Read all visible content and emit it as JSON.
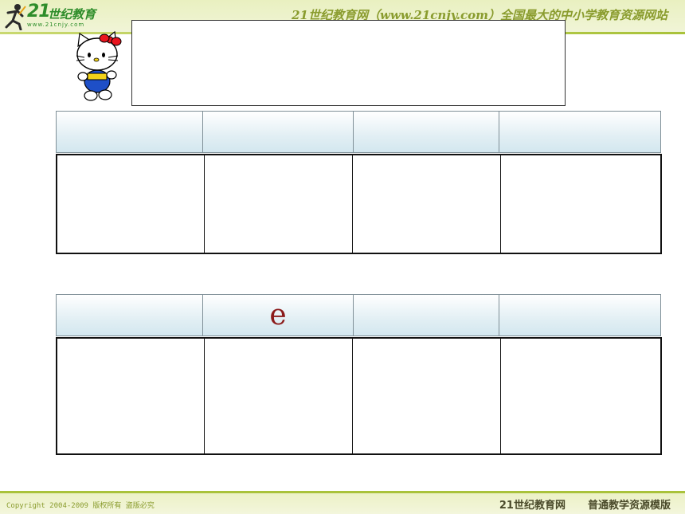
{
  "header": {
    "logo_number": "21",
    "logo_text": "世纪教育",
    "logo_url": "www.21cnjy.com",
    "site_title": "21世纪教育网（www.21cnjy.com）全国最大的中小学教育资源网站"
  },
  "table1": {
    "headers": [
      "",
      "",
      "",
      ""
    ],
    "cells": [
      "",
      "",
      "",
      ""
    ]
  },
  "table2": {
    "headers": [
      "",
      "e",
      "",
      ""
    ],
    "cells": [
      "",
      "",
      "",
      ""
    ]
  },
  "footer": {
    "copyright": "Copyright 2004-2009 版权所有 盗版必究",
    "brand": "21世纪教育网",
    "template_name": "普通教学资源模版"
  },
  "colors": {
    "header_bg": "#e9f0c0",
    "accent_green": "#a9c23a",
    "letter_color": "#8b1a1a"
  }
}
